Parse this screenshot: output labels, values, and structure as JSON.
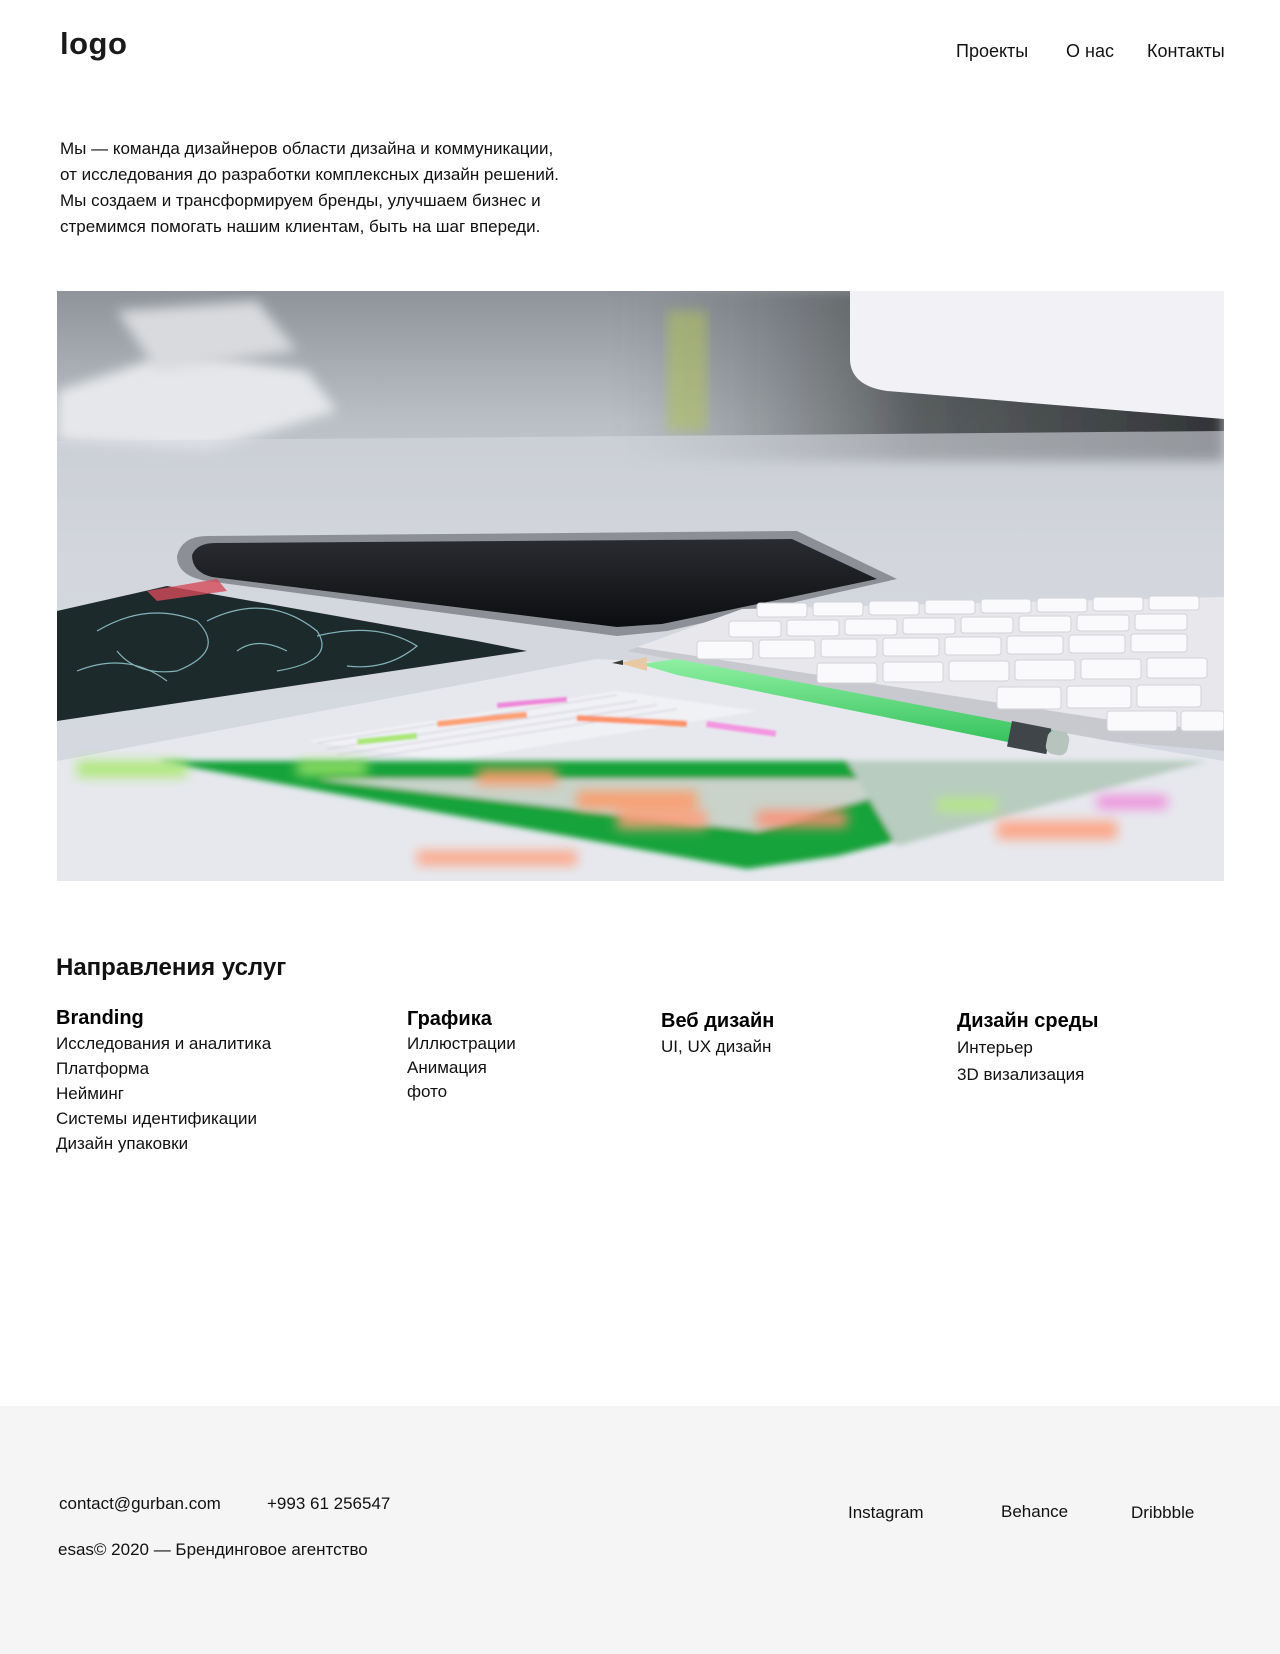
{
  "header": {
    "logo": "logo",
    "nav": [
      {
        "label": "Проекты"
      },
      {
        "label": "О нас"
      },
      {
        "label": "Контакты"
      }
    ]
  },
  "intro": {
    "lines": [
      "Мы — команда дизайнеров  области дизайна и коммуникации,",
      "от исследования до разработки комплексных дизайн решений.",
      "Мы создаем и трансформируем бренды, улучшаем бизнес и",
      "стремимся помогать нашим клиентам, быть на шаг впереди."
    ]
  },
  "hero": {
    "image": "desk-workspace-photo"
  },
  "services": {
    "title": "Направления услуг",
    "columns": [
      {
        "heading": "Branding",
        "items": [
          "Исследования и аналитика",
          "Платформа",
          "Нейминг",
          "Системы идентификации",
          "Дизайн упаковки"
        ]
      },
      {
        "heading": "Графика",
        "items": [
          "Иллюстрации",
          "Анимация",
          "фото"
        ]
      },
      {
        "heading": "Веб дизайн",
        "items": [
          "UI, UX дизайн"
        ]
      },
      {
        "heading": "Дизайн среды",
        "items": [
          "Интерьер",
          "3D визализация"
        ]
      }
    ]
  },
  "footer": {
    "email": "contact@gurban.com",
    "phone": "+993 61 256547",
    "copyright": "esas© 2020 — Брендинговое агентство",
    "social": [
      {
        "label": "Instagram"
      },
      {
        "label": "Behance"
      },
      {
        "label": "Dribbble"
      }
    ]
  },
  "colors": {
    "footer_bg": "#f5f5f5",
    "text": "#111111",
    "background": "#ffffff"
  }
}
